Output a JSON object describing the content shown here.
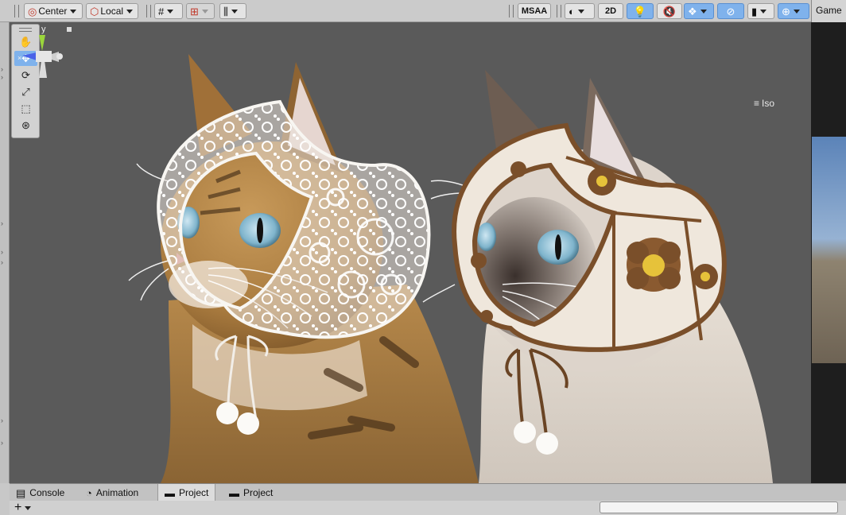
{
  "toolbar": {
    "pivot": "Center",
    "space": "Local",
    "msaa": "MSAA",
    "mode_2d": "2D",
    "dropdown_icons": [
      "grid-snap-icon",
      "increment-snap-icon",
      "ruler-icon",
      "shading-icon",
      "scene-fx-icon",
      "gizmos-icon",
      "camera-icon"
    ]
  },
  "game_tab": {
    "label": "Game"
  },
  "tools": [
    "hand-tool",
    "move-tool",
    "rotate-tool",
    "scale-tool",
    "rect-tool",
    "transform-tool"
  ],
  "gizmo": {
    "axis_label": "y",
    "projection": "Iso"
  },
  "bottom_tabs": [
    {
      "label": "Console",
      "icon": "console-icon"
    },
    {
      "label": "Animation",
      "icon": "animation-icon"
    },
    {
      "label": "Project",
      "icon": "folder-icon",
      "active": true
    },
    {
      "label": "Project",
      "icon": "folder-icon"
    }
  ],
  "bottom_bar": {
    "add_symbol": "+",
    "search_value": ""
  },
  "colors": {
    "viewport_bg": "#5a5a5a",
    "active_blue": "#7fb2ec",
    "tabby_fur": "#a87a3e",
    "siamese_fur": "#ded6cc",
    "lace_bonnet": "#f0ece6",
    "crochet_brown": "#7a4f2a",
    "crochet_yellow": "#e6c23a"
  }
}
